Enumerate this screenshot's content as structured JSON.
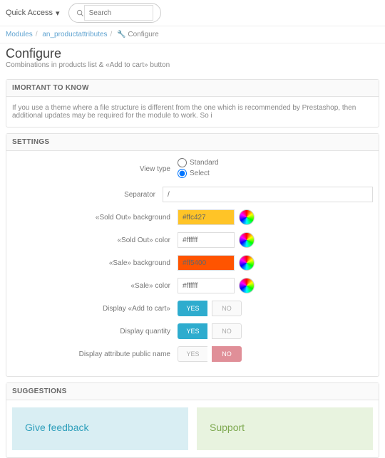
{
  "topbar": {
    "quick_access": "Quick Access",
    "search_placeholder": "Search"
  },
  "breadcrumbs": {
    "a": "Modules",
    "b": "an_productattributes",
    "c": "Configure"
  },
  "page": {
    "title": "Configure",
    "subtitle": "Combinations in products list & «Add to cart» button"
  },
  "important": {
    "head": "IMORTANT TO KNOW",
    "body": "If you use a theme where a file structure is different from the one which is recommended by Prestashop, then additional updates may be required for the module to work. So i"
  },
  "settings": {
    "head": "SETTINGS",
    "labels": {
      "view_type": "View type",
      "standard": "Standard",
      "select": "Select",
      "separator": "Separator",
      "sep_val": "/",
      "soldout_bg": "«Sold Out» background",
      "soldout_bg_val": "#ffc427",
      "soldout_color": "«Sold Out» color",
      "soldout_color_val": "#ffffff",
      "sale_bg": "«Sale» background",
      "sale_bg_val": "#ff5400",
      "sale_color": "«Sale» color",
      "sale_color_val": "#ffffff",
      "display_add": "Display «Add to cart»",
      "display_qty": "Display quantity",
      "display_attr": "Display attribute public name",
      "yes": "YES",
      "no": "NO"
    }
  },
  "suggestions": {
    "head": "SUGGESTIONS",
    "feedback": "Give feedback",
    "support": "Support"
  }
}
